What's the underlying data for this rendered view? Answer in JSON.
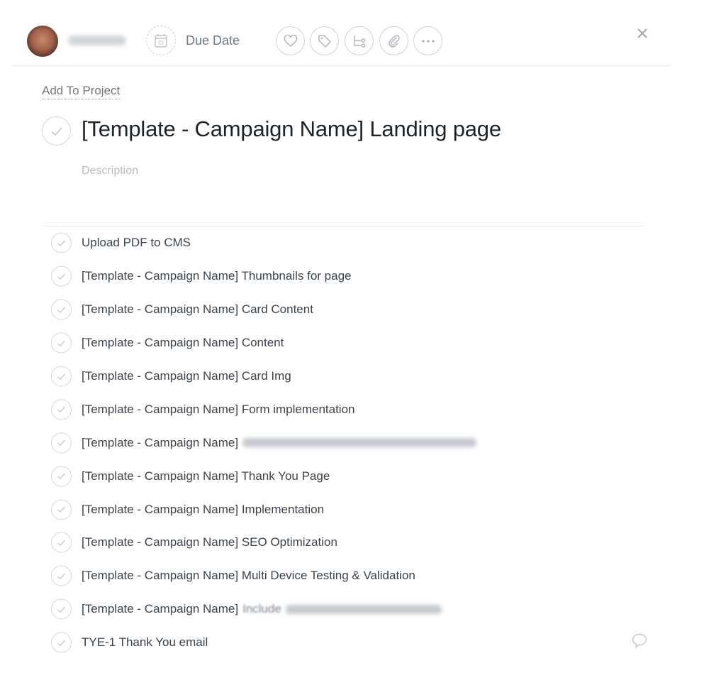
{
  "toolbar": {
    "assignee_name_redacted": true,
    "due_date_label": "Due Date",
    "icons": [
      "heart-icon",
      "tag-icon",
      "subtask-icon",
      "paperclip-icon",
      "more-icon"
    ],
    "close_icon": "close-icon"
  },
  "task": {
    "add_to_project": "Add To Project",
    "title": "[Template - Campaign Name] Landing page",
    "description_placeholder": "Description"
  },
  "subtasks": [
    {
      "text": "Upload PDF to CMS"
    },
    {
      "text": "[Template - Campaign Name] Thumbnails for page"
    },
    {
      "text": "[Template - Campaign Name] Card Content"
    },
    {
      "text": "[Template - Campaign Name] Content"
    },
    {
      "text": "[Template - Campaign Name] Card Img"
    },
    {
      "text": "[Template - Campaign Name] Form implementation"
    },
    {
      "text": "[Template - Campaign Name]",
      "redacted_suffix": true
    },
    {
      "text": "[Template - Campaign Name] Thank You Page"
    },
    {
      "text": "[Template - Campaign Name] Implementation"
    },
    {
      "text": "[Template - Campaign Name] SEO Optimization"
    },
    {
      "text": "[Template - Campaign Name] Multi Device Testing & Validation"
    },
    {
      "text": "[Template - Campaign Name]",
      "visible_suffix": "Include",
      "redacted_suffix": true
    },
    {
      "text": "TYE-1 Thank You email",
      "has_comment_icon": true
    }
  ]
}
